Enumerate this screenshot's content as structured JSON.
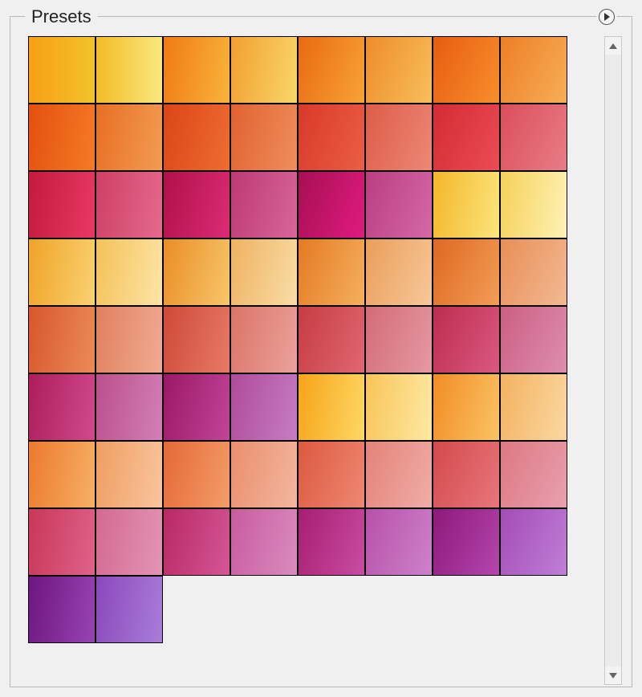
{
  "panel": {
    "title": "Presets",
    "columns": 8,
    "swatches": [
      {
        "from": "#f7a015",
        "to": "#f2c32a",
        "angle": "90deg"
      },
      {
        "from": "#f3bb28",
        "to": "#f9e97e",
        "angle": "90deg"
      },
      {
        "from": "#f07b13",
        "to": "#f9b43a",
        "angle": "100deg"
      },
      {
        "from": "#f2a031",
        "to": "#f9d66a",
        "angle": "100deg"
      },
      {
        "from": "#e96a12",
        "to": "#f8a336",
        "angle": "110deg"
      },
      {
        "from": "#ef8c2b",
        "to": "#f7bf5b",
        "angle": "110deg"
      },
      {
        "from": "#e75d11",
        "to": "#f88e2c",
        "angle": "115deg"
      },
      {
        "from": "#ed7f27",
        "to": "#f7ae56",
        "angle": "115deg"
      },
      {
        "from": "#e3500f",
        "to": "#f57b25",
        "angle": "100deg"
      },
      {
        "from": "#e86f24",
        "to": "#f29c53",
        "angle": "100deg"
      },
      {
        "from": "#db4518",
        "to": "#ee6d31",
        "angle": "105deg"
      },
      {
        "from": "#e16231",
        "to": "#ef8e5c",
        "angle": "105deg"
      },
      {
        "from": "#d93929",
        "to": "#eb5e46",
        "angle": "110deg"
      },
      {
        "from": "#de5c48",
        "to": "#ec8877",
        "angle": "110deg"
      },
      {
        "from": "#d42b33",
        "to": "#eb4c56",
        "angle": "115deg"
      },
      {
        "from": "#db4e5b",
        "to": "#e87d87",
        "angle": "115deg"
      },
      {
        "from": "#c41a3e",
        "to": "#e83964",
        "angle": "100deg"
      },
      {
        "from": "#cf3f65",
        "to": "#e46a8d",
        "angle": "100deg"
      },
      {
        "from": "#b1104a",
        "to": "#db2c75",
        "angle": "105deg"
      },
      {
        "from": "#bd3a73",
        "to": "#d7669a",
        "angle": "105deg"
      },
      {
        "from": "#a70e54",
        "to": "#e01b7f",
        "angle": "110deg"
      },
      {
        "from": "#b93e82",
        "to": "#d568a8",
        "angle": "110deg"
      },
      {
        "from": "#f3b72b",
        "to": "#fbe57c",
        "angle": "100deg"
      },
      {
        "from": "#f6d15a",
        "to": "#fef2b6",
        "angle": "100deg"
      },
      {
        "from": "#f0a329",
        "to": "#f9d271",
        "angle": "100deg"
      },
      {
        "from": "#f4c159",
        "to": "#fde5a7",
        "angle": "100deg"
      },
      {
        "from": "#ea8e26",
        "to": "#f7c66b",
        "angle": "105deg"
      },
      {
        "from": "#efb261",
        "to": "#f9dda7",
        "angle": "105deg"
      },
      {
        "from": "#e57a23",
        "to": "#f4b05f",
        "angle": "110deg"
      },
      {
        "from": "#eb9e5a",
        "to": "#f6c89a",
        "angle": "110deg"
      },
      {
        "from": "#df6823",
        "to": "#f19e56",
        "angle": "115deg"
      },
      {
        "from": "#e88f57",
        "to": "#f3b993",
        "angle": "115deg"
      },
      {
        "from": "#d8572c",
        "to": "#eb8b58",
        "angle": "100deg"
      },
      {
        "from": "#e1805f",
        "to": "#f0ab93",
        "angle": "100deg"
      },
      {
        "from": "#cf4938",
        "to": "#e77a67",
        "angle": "105deg"
      },
      {
        "from": "#db7468",
        "to": "#eba29b",
        "angle": "105deg"
      },
      {
        "from": "#c73c44",
        "to": "#e06770",
        "angle": "110deg"
      },
      {
        "from": "#d36c77",
        "to": "#e599a4",
        "angle": "110deg"
      },
      {
        "from": "#bd2d50",
        "to": "#db5880",
        "angle": "115deg"
      },
      {
        "from": "#cb5f84",
        "to": "#de8eac",
        "angle": "115deg"
      },
      {
        "from": "#ad1d5b",
        "to": "#d14a8d",
        "angle": "100deg"
      },
      {
        "from": "#bc4f8f",
        "to": "#d280b6",
        "angle": "100deg"
      },
      {
        "from": "#9b1866",
        "to": "#c14598",
        "angle": "105deg"
      },
      {
        "from": "#af4b9c",
        "to": "#c67dc2",
        "angle": "105deg"
      },
      {
        "from": "#f6a419",
        "to": "#fed864",
        "angle": "100deg"
      },
      {
        "from": "#f8c559",
        "to": "#fee9a4",
        "angle": "100deg"
      },
      {
        "from": "#f18d25",
        "to": "#fbc365",
        "angle": "105deg"
      },
      {
        "from": "#f3b260",
        "to": "#fbd8a2",
        "angle": "105deg"
      },
      {
        "from": "#eb7a2d",
        "to": "#f7b066",
        "angle": "100deg"
      },
      {
        "from": "#ef9e62",
        "to": "#f9c59e",
        "angle": "100deg"
      },
      {
        "from": "#e56937",
        "to": "#f39d69",
        "angle": "105deg"
      },
      {
        "from": "#ea8f6c",
        "to": "#f3b6a0",
        "angle": "105deg"
      },
      {
        "from": "#dd5940",
        "to": "#ee8872",
        "angle": "110deg"
      },
      {
        "from": "#e48378",
        "to": "#efada8",
        "angle": "110deg"
      },
      {
        "from": "#d44a4b",
        "to": "#e7767d",
        "angle": "115deg"
      },
      {
        "from": "#dc7883",
        "to": "#e9a0ae",
        "angle": "115deg"
      },
      {
        "from": "#c93758",
        "to": "#df628a",
        "angle": "100deg"
      },
      {
        "from": "#d46991",
        "to": "#e295b5",
        "angle": "100deg"
      },
      {
        "from": "#b92964",
        "to": "#d45697",
        "angle": "105deg"
      },
      {
        "from": "#c85c9c",
        "to": "#da8bc1",
        "angle": "105deg"
      },
      {
        "from": "#a71e71",
        "to": "#c84da3",
        "angle": "110deg"
      },
      {
        "from": "#b851a9",
        "to": "#cd82cb",
        "angle": "110deg"
      },
      {
        "from": "#8e197b",
        "to": "#b346ad",
        "angle": "115deg"
      },
      {
        "from": "#a44cb6",
        "to": "#bf7fd7",
        "angle": "115deg"
      },
      {
        "from": "#6e1580",
        "to": "#9744b2",
        "angle": "100deg"
      },
      {
        "from": "#8b48bb",
        "to": "#a97dd9",
        "angle": "100deg"
      }
    ]
  }
}
